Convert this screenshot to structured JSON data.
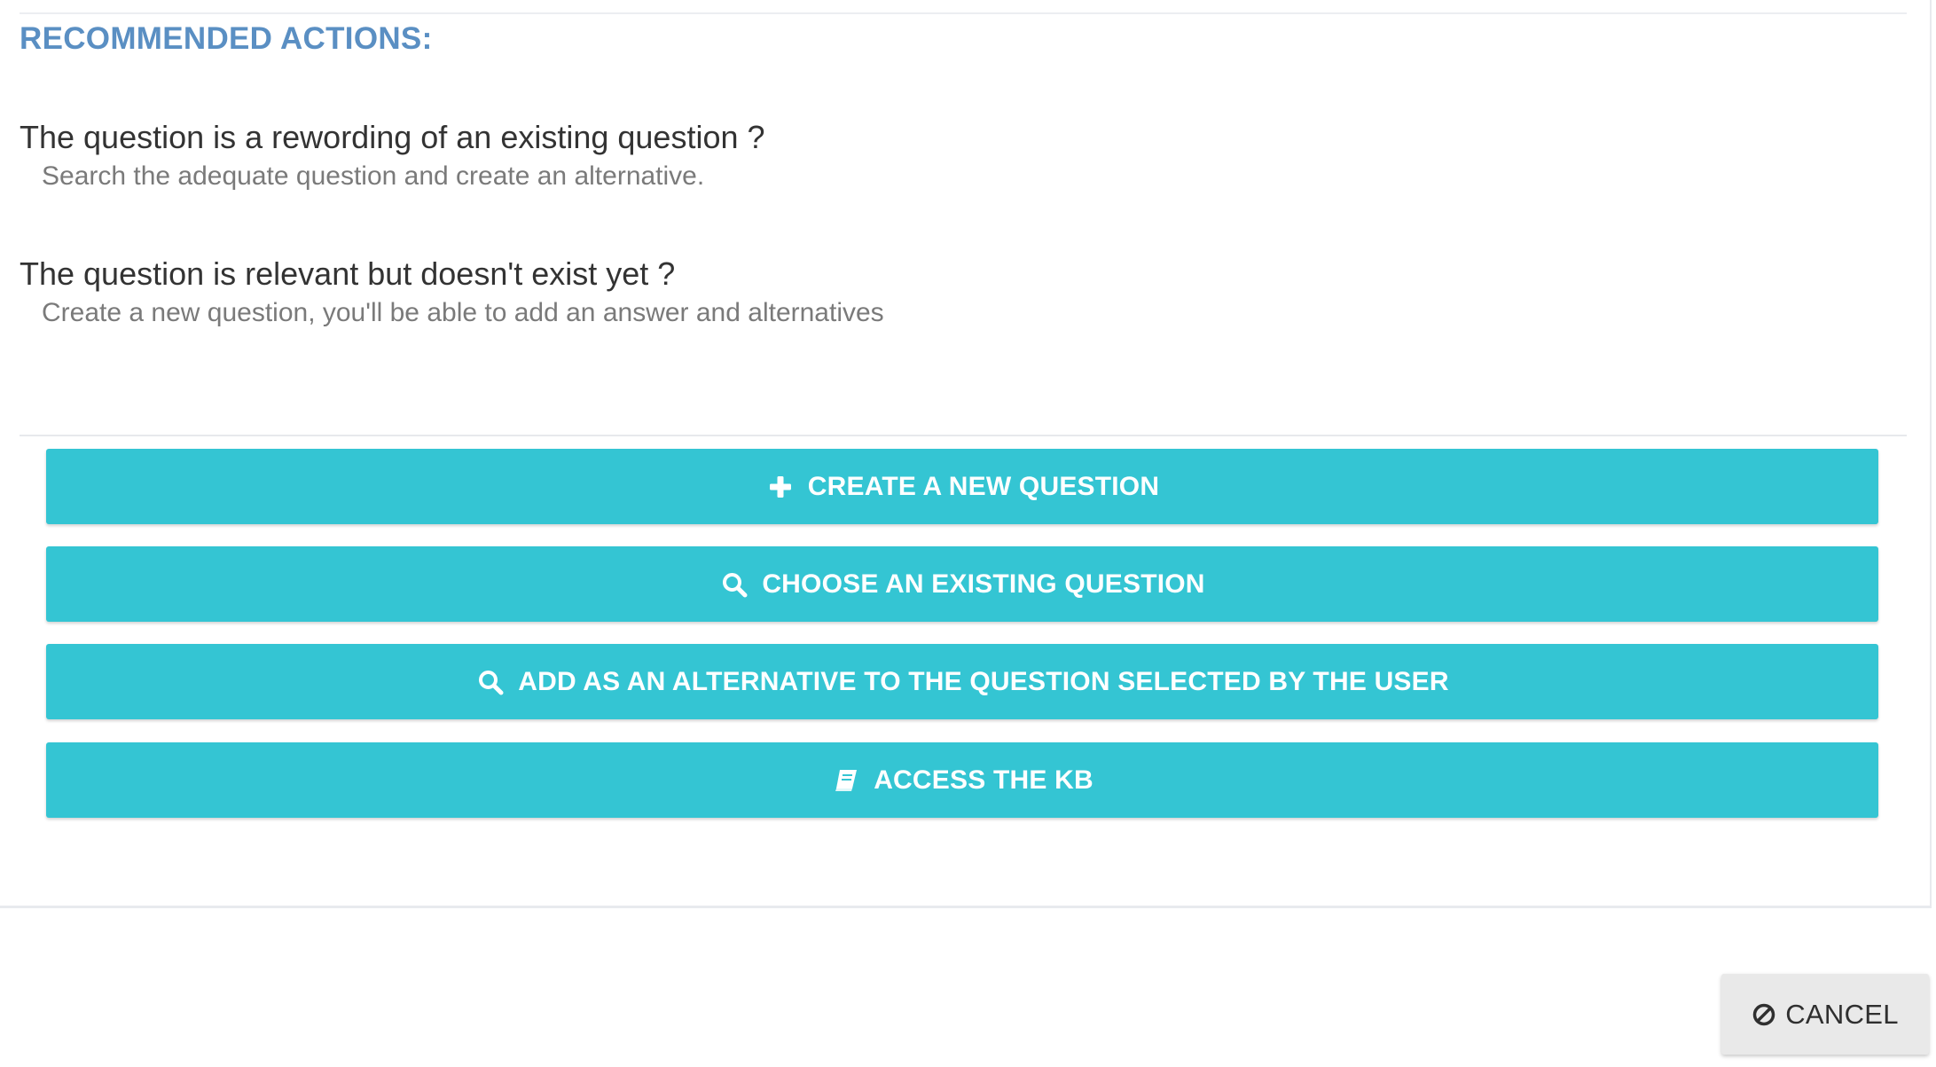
{
  "section": {
    "title": "RECOMMENDED ACTIONS:"
  },
  "scenarios": [
    {
      "question": "The question is a rewording of an existing question ?",
      "hint": "Search the adequate question and create an alternative."
    },
    {
      "question": "The question is relevant but doesn't exist yet ?",
      "hint": "Create a new question, you'll be able to add an answer and alternatives"
    }
  ],
  "actions": [
    {
      "label": "CREATE A NEW QUESTION",
      "icon": "plus-icon"
    },
    {
      "label": "CHOOSE AN EXISTING QUESTION",
      "icon": "search-icon"
    },
    {
      "label": "ADD AS AN ALTERNATIVE TO THE QUESTION SELECTED BY THE USER",
      "icon": "search-icon"
    },
    {
      "label": "ACCESS THE KB",
      "icon": "book-icon"
    }
  ],
  "footer": {
    "cancel_label": "CANCEL",
    "cancel_icon": "ban-icon"
  },
  "colors": {
    "title": "#5a8fc3",
    "action_button": "#34c5d3",
    "cancel_button": "#e9e9e9"
  }
}
